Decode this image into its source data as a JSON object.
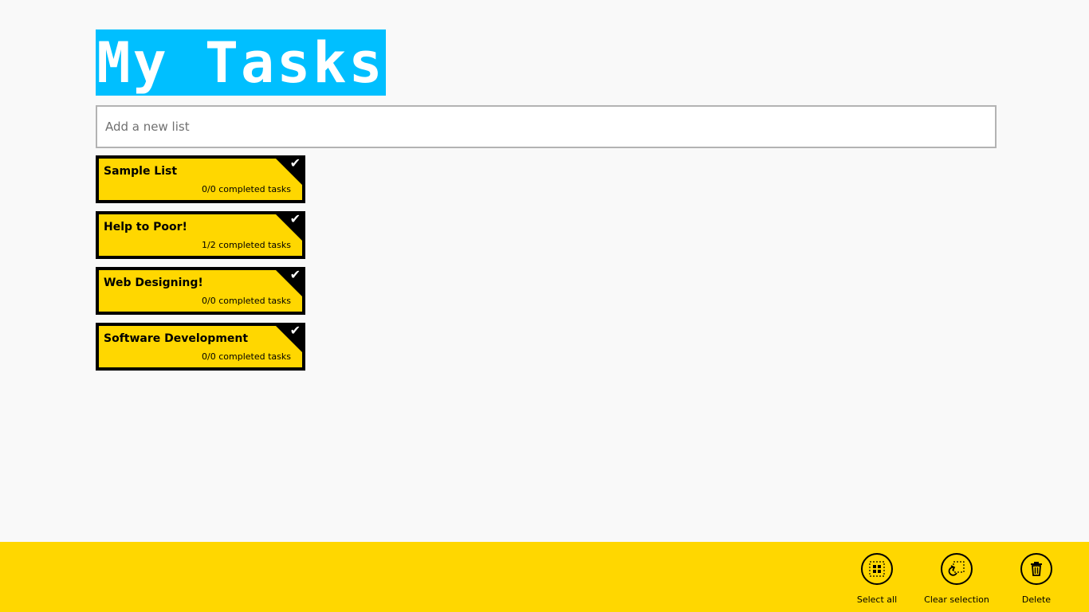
{
  "header": {
    "title": "My Tasks",
    "banner_color": "#00bfff"
  },
  "add_list": {
    "placeholder": "Add a new list",
    "value": ""
  },
  "lists": [
    {
      "title": "Sample List",
      "status": "0/0 completed tasks",
      "selected": true
    },
    {
      "title": "Help to Poor!",
      "status": "1/2 completed tasks",
      "selected": true
    },
    {
      "title": "Web Designing!",
      "status": "0/0 completed tasks",
      "selected": true
    },
    {
      "title": "Software Development",
      "status": "0/0 completed tasks",
      "selected": true
    }
  ],
  "tile_colors": {
    "background": "#ffd700",
    "border": "#000000",
    "check": "#ffffff"
  },
  "app_bar": {
    "background": "#ffd700",
    "commands": [
      {
        "label": "Select all",
        "icon": "select-all-icon"
      },
      {
        "label": "Clear selection",
        "icon": "clear-selection-icon"
      },
      {
        "label": "Delete",
        "icon": "trash-icon"
      }
    ]
  }
}
